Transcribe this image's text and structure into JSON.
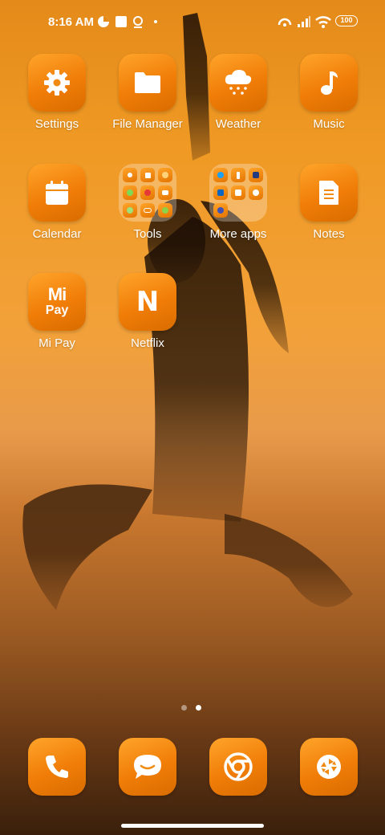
{
  "status_bar": {
    "time": "8:16 AM",
    "battery": "100"
  },
  "apps": {
    "settings": "Settings",
    "file_manager": "File Manager",
    "weather": "Weather",
    "music": "Music",
    "calendar": "Calendar",
    "tools": "Tools",
    "more_apps": "More apps",
    "notes": "Notes",
    "mi_pay": "Mi Pay",
    "netflix": "Netflix"
  },
  "icon_text": {
    "mi_pay_top": "Mi",
    "mi_pay_bottom": "Pay",
    "netflix": "N"
  },
  "tools_folder": [
    "contacts-icon",
    "apps-grid-icon",
    "clock-icon",
    "android-icon",
    "record-icon",
    "video-icon",
    "app-icon",
    "infinity-icon",
    "leaf-icon"
  ],
  "more_apps_folder": [
    "twitter-icon",
    "facebook-icon",
    "paypal-icon",
    "linkedin-icon",
    "mall-icon",
    "clock-icon",
    "app-icon"
  ],
  "page_indicator": {
    "pages": 2,
    "current": 2
  },
  "dock": [
    "phone-icon",
    "messages-icon",
    "browser-icon",
    "camera-icon"
  ],
  "colors": {
    "icon_orange": "#f28a10",
    "bg_top": "#e48a1a",
    "bg_bottom": "#3a200c"
  }
}
